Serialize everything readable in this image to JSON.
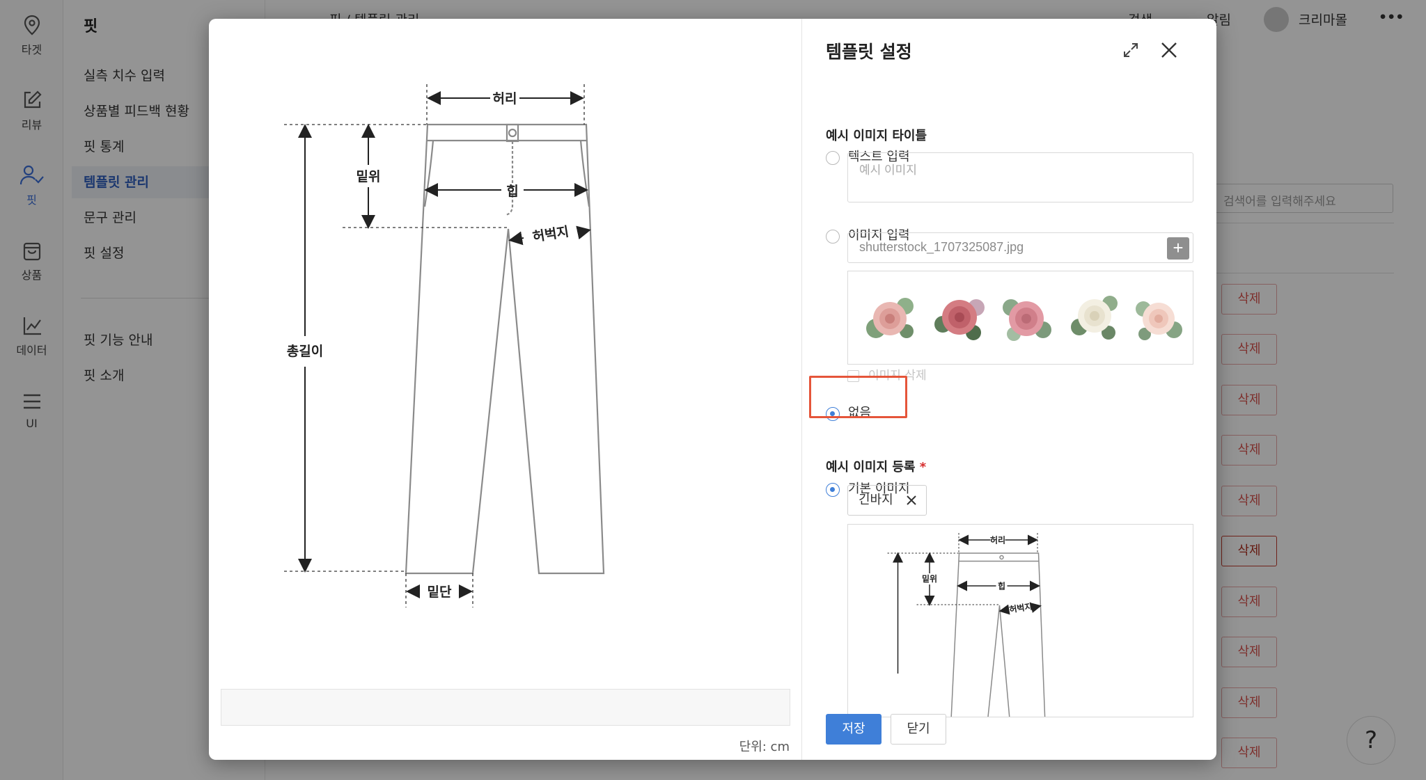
{
  "rail": [
    {
      "icon": "pin-icon",
      "label": "타겟"
    },
    {
      "icon": "edit-icon",
      "label": "리뷰"
    },
    {
      "icon": "user-check-icon",
      "label": "핏"
    },
    {
      "icon": "bag-icon",
      "label": "상품"
    },
    {
      "icon": "chart-icon",
      "label": "데이터"
    },
    {
      "icon": "menu-icon",
      "label": "UI"
    }
  ],
  "subnav": {
    "title": "핏",
    "items": [
      "실측 치수 입력",
      "상품별 피드백 현황",
      "핏 통계",
      "템플릿 관리",
      "문구 관리",
      "핏 설정"
    ],
    "items2": [
      "핏 기능 안내",
      "핏 소개"
    ]
  },
  "topbar": {
    "breadcrumb": "핏 / 템플릿 관리",
    "search": "검색",
    "alerts": "알림",
    "user": "크리마몰"
  },
  "list": {
    "search_placeholder": "검색어를 입력해주세요",
    "delete_label": "삭제"
  },
  "help": "?",
  "preview": {
    "labels": {
      "waist": "허리",
      "rise": "밑위",
      "hip": "힙",
      "thigh": "허벅지",
      "length": "총길이",
      "hem": "밑단"
    },
    "unit": "단위: cm"
  },
  "panel": {
    "title": "템플릿 설정",
    "title_section": "예시 이미지 타이틀",
    "opt_text": "텍스트 입력",
    "text_placeholder": "예시 이미지",
    "opt_image": "이미지 입력",
    "file_name": "shutterstock_1707325087.jpg",
    "delete_image": "이미지 삭제",
    "opt_none": "없음",
    "register_section": "예시 이미지 등록",
    "required_mark": "*",
    "opt_default": "기본 이미지",
    "chip": "긴바지",
    "save": "저장",
    "cancel": "닫기"
  },
  "colors": {
    "accent": "#3f7fd8",
    "danger": "#d9534f",
    "highlight": "#e5553a"
  }
}
